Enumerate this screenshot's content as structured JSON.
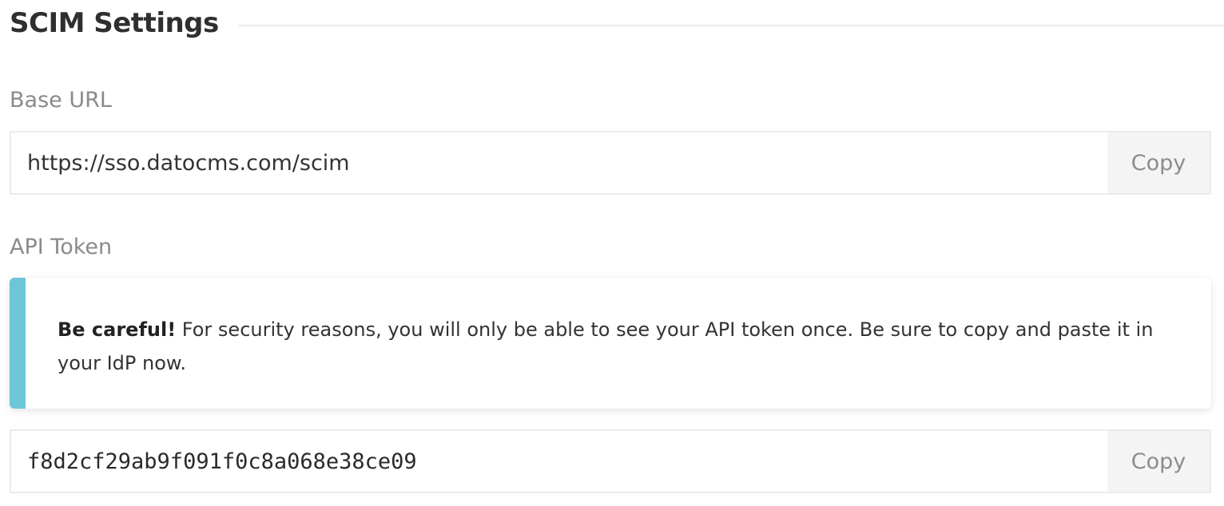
{
  "section": {
    "title": "SCIM Settings"
  },
  "base_url": {
    "label": "Base URL",
    "value": "https://sso.datocms.com/scim",
    "copy_label": "Copy"
  },
  "api_token": {
    "label": "API Token",
    "notice": {
      "strong": "Be careful!",
      "text": " For security reasons, you will only be able to see your API token once. Be sure to copy and paste it in your IdP now."
    },
    "value": "f8d2cf29ab9f091f0c8a068e38ce09",
    "copy_label": "Copy"
  },
  "colors": {
    "notice_accent": "#6cc6d8",
    "copy_button_bg": "#f4f4f4"
  }
}
